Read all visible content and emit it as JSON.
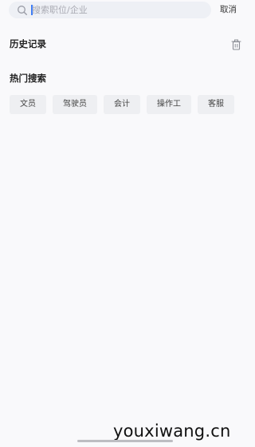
{
  "search": {
    "placeholder": "搜索职位/企业",
    "cancel_label": "取消"
  },
  "history": {
    "title": "历史记录",
    "clear_icon": "trash-icon"
  },
  "hot_search": {
    "title": "热门搜索",
    "tags": [
      "文员",
      "驾驶员",
      "会计",
      "操作工",
      "客服"
    ]
  },
  "watermark": {
    "text": "youxiwang.cn"
  },
  "colors": {
    "caret": "#3d7bf5",
    "search_bg": "#eef0f5",
    "tag_bg": "#eeeff2",
    "page_bg": "#f9f9fb"
  }
}
